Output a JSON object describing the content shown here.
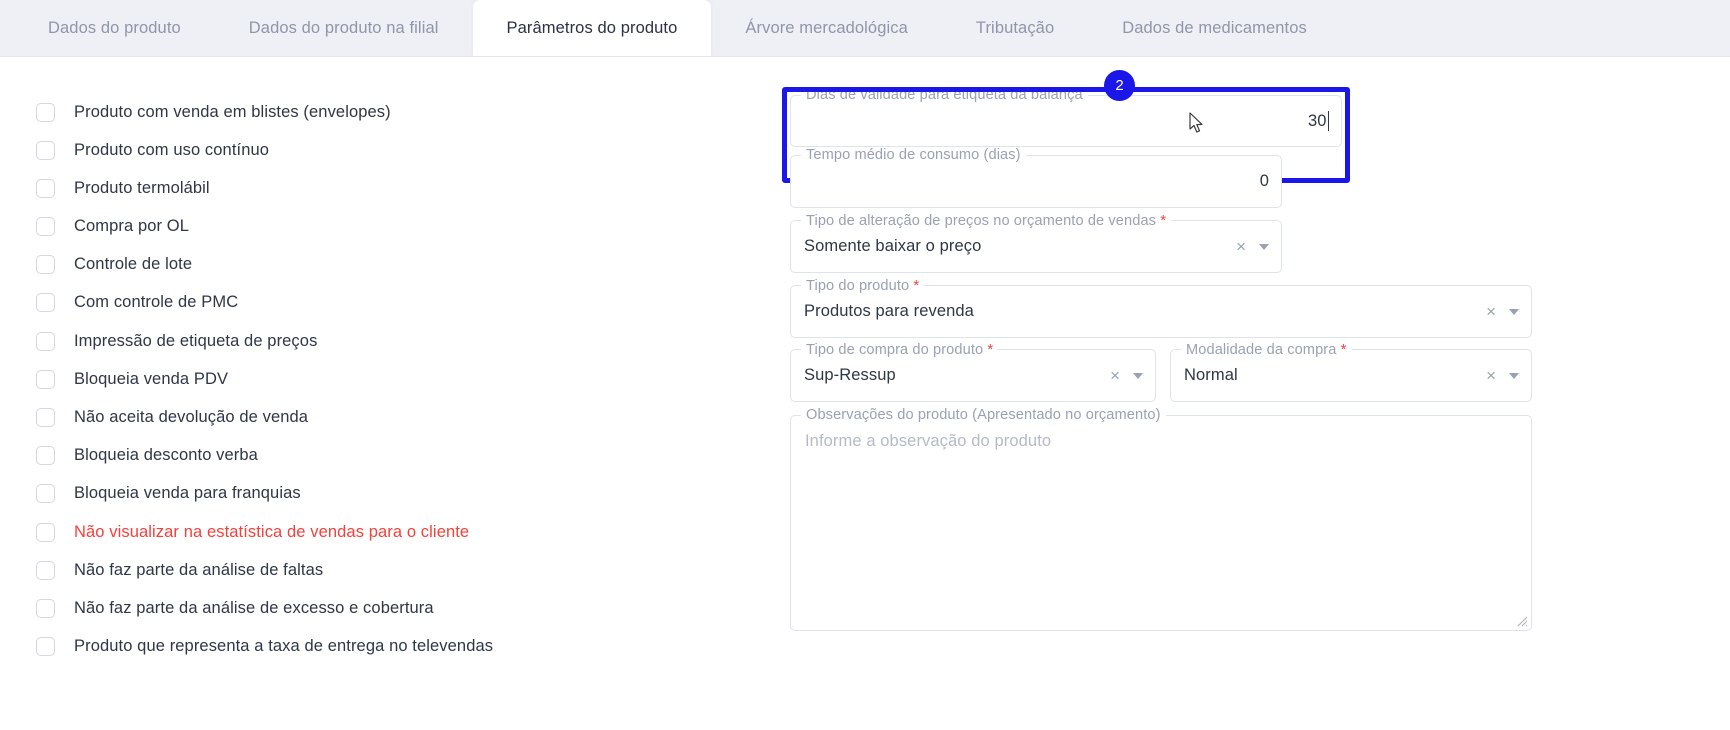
{
  "tabs": [
    {
      "label": "Dados do produto",
      "active": false
    },
    {
      "label": "Dados do produto na filial",
      "active": false
    },
    {
      "label": "Parâmetros do produto",
      "active": true
    },
    {
      "label": "Árvore mercadológica",
      "active": false
    },
    {
      "label": "Tributação",
      "active": false
    },
    {
      "label": "Dados de medicamentos",
      "active": false
    }
  ],
  "checkboxes": [
    {
      "label": "Produto com venda em blistes (envelopes)",
      "checked": false,
      "danger": false
    },
    {
      "label": "Produto com uso contínuo",
      "checked": false,
      "danger": false
    },
    {
      "label": "Produto termolábil",
      "checked": false,
      "danger": false
    },
    {
      "label": "Compra por OL",
      "checked": false,
      "danger": false
    },
    {
      "label": "Controle de lote",
      "checked": false,
      "danger": false
    },
    {
      "label": "Com controle de PMC",
      "checked": false,
      "danger": false
    },
    {
      "label": "Impressão de etiqueta de preços",
      "checked": false,
      "danger": false
    },
    {
      "label": "Bloqueia venda PDV",
      "checked": false,
      "danger": false
    },
    {
      "label": "Não aceita devolução de venda",
      "checked": false,
      "danger": false
    },
    {
      "label": "Bloqueia desconto verba",
      "checked": false,
      "danger": false
    },
    {
      "label": "Bloqueia venda para franquias",
      "checked": false,
      "danger": false
    },
    {
      "label": "Não visualizar na estatística de vendas para o cliente",
      "checked": false,
      "danger": true
    },
    {
      "label": "Não faz parte da análise de faltas",
      "checked": false,
      "danger": false
    },
    {
      "label": "Não faz parte da análise de excesso e cobertura",
      "checked": false,
      "danger": false
    },
    {
      "label": "Produto que representa a taxa de entrega no televendas",
      "checked": false,
      "danger": false
    }
  ],
  "fields": {
    "dias_validade": {
      "label": "Dias de validade para etiqueta da balança",
      "value": "30",
      "required": false
    },
    "tempo_medio": {
      "label": "Tempo médio de consumo (dias)",
      "value": "0",
      "required": false
    },
    "tipo_alteracao": {
      "label": "Tipo de alteração de preços no orçamento de vendas",
      "required_mark": "*",
      "value": "Somente baixar o preço",
      "clear_icon": "×",
      "dropdown_icon": "chevron-down"
    },
    "tipo_produto": {
      "label": "Tipo do produto",
      "required_mark": "*",
      "value": "Produtos para revenda",
      "clear_icon": "×",
      "dropdown_icon": "chevron-down"
    },
    "tipo_compra": {
      "label": "Tipo de compra do produto",
      "required_mark": "*",
      "value": "Sup-Ressup",
      "clear_icon": "×",
      "dropdown_icon": "chevron-down"
    },
    "modalidade_compra": {
      "label": "Modalidade da compra",
      "required_mark": "*",
      "value": "Normal",
      "clear_icon": "×",
      "dropdown_icon": "chevron-down"
    },
    "observacoes": {
      "label": "Observações do produto (Apresentado no orçamento)",
      "placeholder": "Informe a observação do produto",
      "value": ""
    }
  },
  "annotation": {
    "badge_number": "2",
    "color": "#1a17e8"
  },
  "colors": {
    "tabbar_bg": "#eef0f6",
    "tab_active_bg": "#ffffff",
    "tab_inactive_text": "#8f96aa",
    "text_primary": "#2f3646",
    "label_muted": "#9aa1b4",
    "danger": "#f4413b",
    "field_border": "#dfe3ec",
    "highlight": "#1a17e8"
  }
}
